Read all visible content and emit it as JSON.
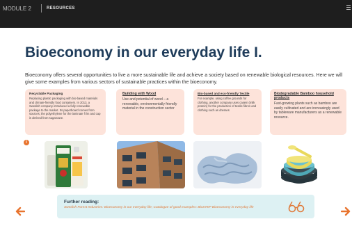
{
  "header": {
    "module": "MODULE 2",
    "section": "RESOURCES"
  },
  "page": {
    "title": "Bioeconomy in our everyday life I.",
    "intro": "Bioeconomy offers several opportunities to live a more sustainable life and achieve a society based on renewable biological resources. Here we will give some examples from various sectors of sustainable practices within the bioeconomy."
  },
  "cards": [
    {
      "title": "Recyclable Packaging",
      "body": "Replacing plastic packaging with bio-based materials and climate-friendly food containers. In 2013, a Swedish company introduced a fully renewable package to the market. Its paperboard comes from sources; the polyethylene for the laminate fi lm and cap is derived from sugarcane."
    },
    {
      "title": "Building with Wood",
      "body": "Use and potential of wood – a renewable, environmentally friendly material in the construction sector"
    },
    {
      "title": "Bio-based and eco-friendly Textile",
      "body": "For example, using coffee grounds for clothing, another company uses casein (milk protein) for the production of textile fibres and clothing such as dresses"
    },
    {
      "title": "Biodegradable Bamboo household products",
      "body": "Fast-growing plants such as bamboo are easily cultivated and are increasingly used by tableware manufacturers as a renewable resource."
    }
  ],
  "info_icon": "i",
  "further_reading": {
    "title": "Further reading:",
    "links": "Swedish Forest Industries: Bioeconomy in our everyday life; Catalogue of good examples: BioSTEP Bioeconomy in everyday life"
  },
  "colors": {
    "topbar": "#1e1e1e",
    "title": "#1f3c5a",
    "card_bg": "#fde3da",
    "accent": "#e8742e",
    "reading_bg": "#ddf1f3"
  },
  "icons": [
    "info-icon",
    "glasses-icon",
    "arrow-left-icon",
    "arrow-right-icon",
    "menu-icon"
  ]
}
